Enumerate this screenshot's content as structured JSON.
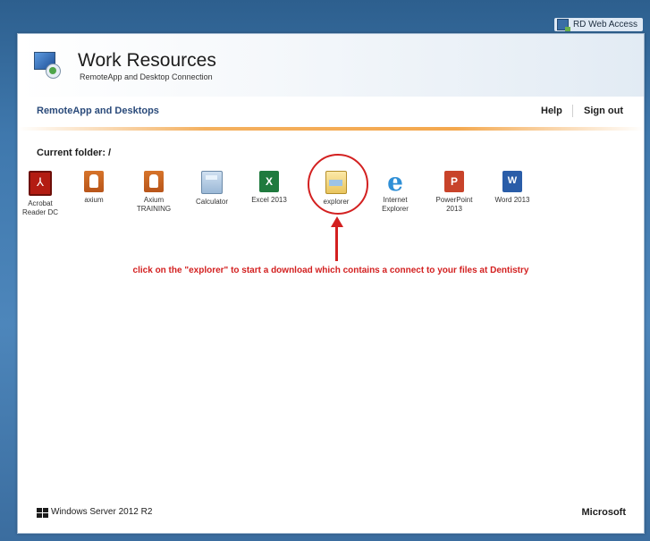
{
  "top_bar": {
    "label": "RD Web Access",
    "icon": "rd-web-access-icon"
  },
  "header": {
    "title": "Work Resources",
    "subtitle": "RemoteApp and Desktop Connection",
    "logo_icon": "remoteapp-logo-icon"
  },
  "nav": {
    "section": "RemoteApp and Desktops",
    "help": "Help",
    "sign_out": "Sign out"
  },
  "current_folder": "Current folder: /",
  "apps": [
    {
      "label": "Acrobat\nReader DC",
      "icon": "acrobat-icon"
    },
    {
      "label": "axium",
      "icon": "axium-icon"
    },
    {
      "label": "Axium\nTRAINING",
      "icon": "axium-training-icon"
    },
    {
      "label": "Calculator",
      "icon": "calculator-icon"
    },
    {
      "label": "Excel 2013",
      "icon": "excel-icon"
    },
    {
      "label": "explorer",
      "icon": "explorer-icon"
    },
    {
      "label": "Internet\nExplorer",
      "icon": "internet-explorer-icon"
    },
    {
      "label": "PowerPoint\n2013",
      "icon": "powerpoint-icon"
    },
    {
      "label": "Word 2013",
      "icon": "word-icon"
    }
  ],
  "annotation": "click on the \"explorer\" to start a download which contains a connect to your files at Dentistry",
  "footer": {
    "os": "Windows Server 2012 R2",
    "vendor": "Microsoft"
  },
  "colors": {
    "annotation_red": "#d32020",
    "nav_blue": "#2a4a7a",
    "accent_orange": "#f4a84e"
  }
}
